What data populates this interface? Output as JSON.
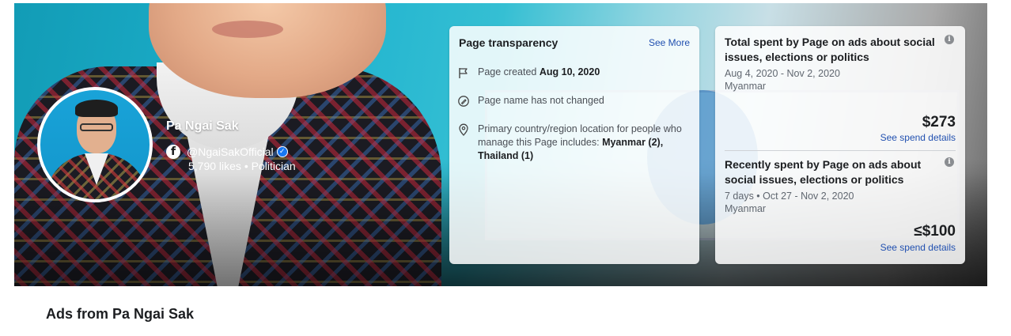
{
  "profile": {
    "name": "Pa Ngai Sak",
    "handle": "@NgaiSakOfficial",
    "likes": "5,790 likes",
    "separator": "•",
    "category": "Politician"
  },
  "transparency": {
    "title": "Page transparency",
    "see_more": "See More",
    "created_label": "Page created",
    "created_date": "Aug 10, 2020",
    "name_changed": "Page name has not changed",
    "location_text": "Primary country/region location for people who manage this Page includes:",
    "location_values": "Myanmar (2), Thailand (1)"
  },
  "spend": {
    "total": {
      "title": "Total spent by Page on ads about social issues, elections or politics",
      "date_range": "Aug 4, 2020 - Nov 2, 2020",
      "region": "Myanmar",
      "amount": "$273",
      "link": "See spend details"
    },
    "recent": {
      "title": "Recently spent by Page on ads about social issues, elections or politics",
      "date_range": "7 days • Oct 27 - Nov 2, 2020",
      "region": "Myanmar",
      "amount": "≤$100",
      "link": "See spend details"
    },
    "info_glyph": "i"
  },
  "section": {
    "title": "Ads from Pa Ngai Sak"
  },
  "icons": {
    "facebook": "f",
    "verified": "✓"
  },
  "colors": {
    "link": "#2150b0",
    "verified": "#1877f2"
  }
}
